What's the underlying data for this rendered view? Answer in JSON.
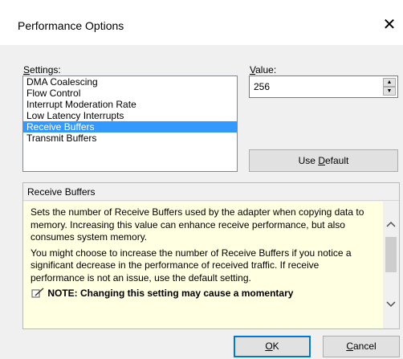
{
  "window": {
    "title": "Performance Options",
    "close_glyph": "✕"
  },
  "settings": {
    "label_prefix": "",
    "label_mnemonic": "S",
    "label_rest": "ettings:",
    "items": [
      {
        "label": "DMA Coalescing",
        "selected": false
      },
      {
        "label": "Flow Control",
        "selected": false
      },
      {
        "label": "Interrupt Moderation Rate",
        "selected": false
      },
      {
        "label": "Low Latency Interrupts",
        "selected": false
      },
      {
        "label": "Receive Buffers",
        "selected": true
      },
      {
        "label": "Transmit Buffers",
        "selected": false
      }
    ]
  },
  "value": {
    "label_mnemonic": "V",
    "label_rest": "alue:",
    "current": "256"
  },
  "buttons": {
    "use_default_prefix": "Use ",
    "use_default_mnemonic": "D",
    "use_default_rest": "efault",
    "ok_mnemonic": "O",
    "ok_rest": "K",
    "cancel_mnemonic": "C",
    "cancel_rest": "ancel"
  },
  "help": {
    "header": "Receive Buffers",
    "para1": "Sets the number of Receive Buffers used by the adapter when copying data to memory. Increasing this value can enhance receive performance, but also consumes system memory.",
    "para2": "You might choose to increase the number of Receive Buffers if you notice a significant decrease in the performance of received traffic. If receive performance is not an issue, use the default setting.",
    "note": "NOTE: Changing this setting may cause a momentary"
  },
  "colors": {
    "selection": "#3399ff",
    "help_bg": "#ffffe1",
    "focus_border": "#0078d7"
  }
}
